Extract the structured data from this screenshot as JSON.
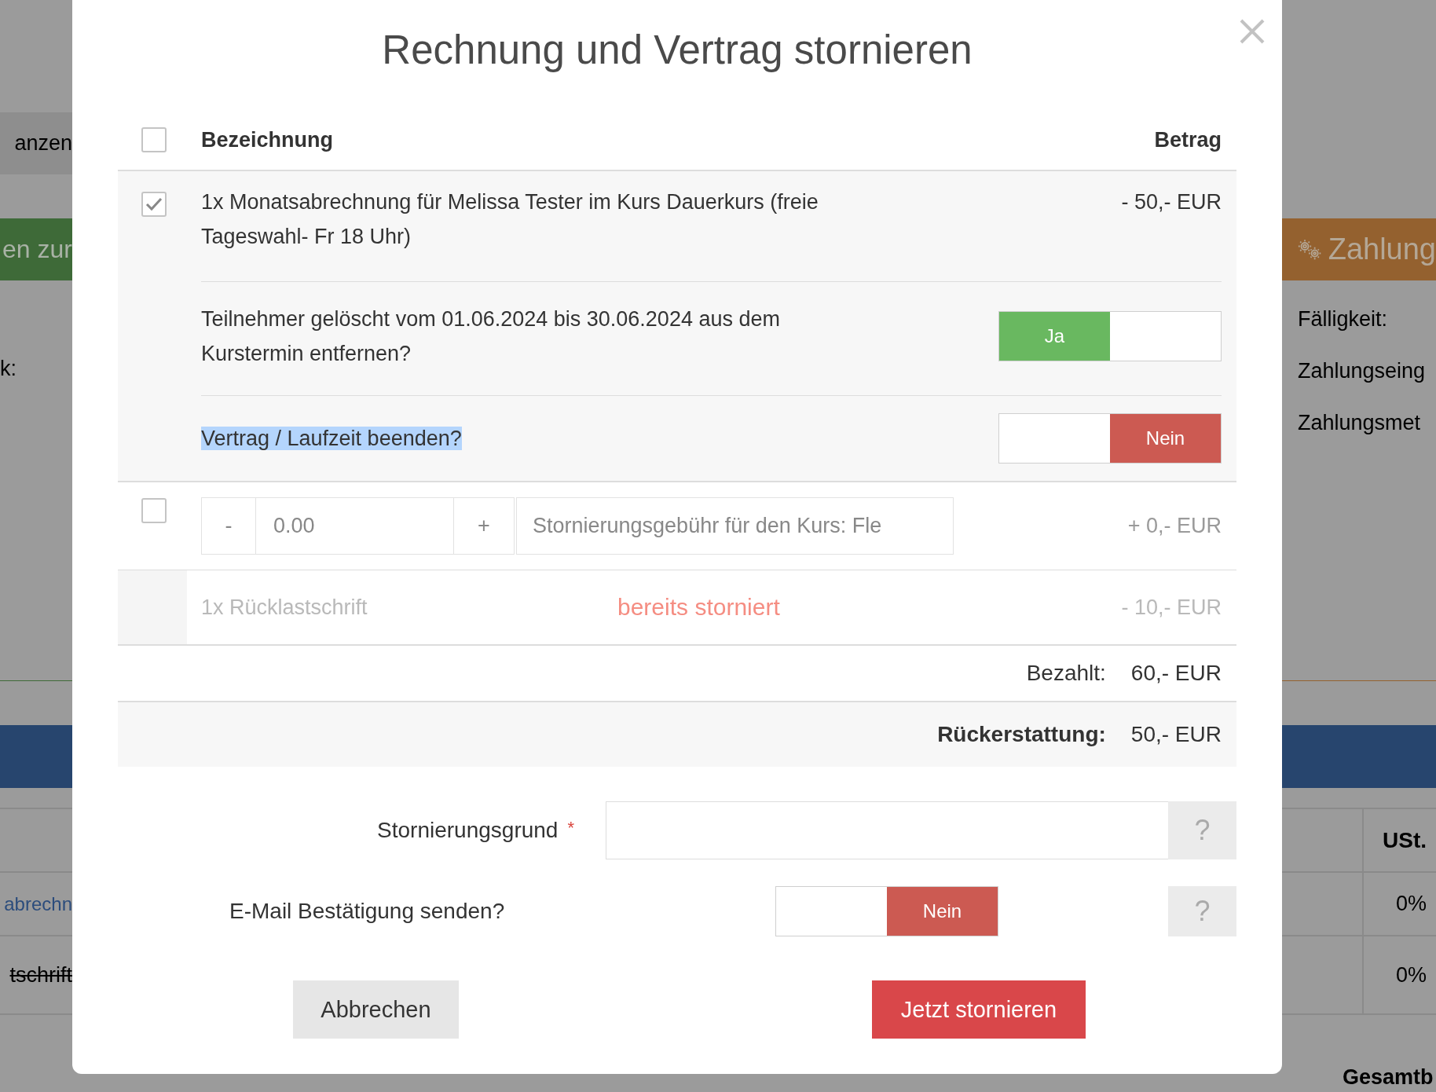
{
  "background_page": {
    "tab_text": "anzen",
    "left_banner": "en zur",
    "left_label": "k:",
    "right_banner": "Zahlung",
    "right_fields": [
      "Fälligkeit:",
      "Zahlungseing",
      "Zahlungsmet"
    ],
    "table": {
      "header": "USt.",
      "rows": [
        {
          "kind": "link",
          "text": "abrechn",
          "vat": "0%"
        },
        {
          "kind": "cancelled",
          "text": "tschrift",
          "vat": "0%"
        }
      ]
    },
    "footer": "Gesamtb"
  },
  "dialog": {
    "title": "Rechnung und Vertrag stornieren",
    "table": {
      "select_all": {
        "checked": false
      },
      "columns": [
        "Bezeichnung",
        "Betrag"
      ],
      "items": [
        {
          "kind": "invoice",
          "checked": true,
          "text": "1x Monatsabrechnung für Melissa Tester im Kurs Dauerkurs (freie Tageswahl- Fr 18 Uhr)",
          "amount": "- 50,- EUR",
          "options": [
            {
              "label": "Teilnehmer gelöscht vom 01.06.2024 bis 30.06.2024 aus dem Kurstermin entfernen?",
              "highlighted": false,
              "toggle": {
                "on": true,
                "label": "Ja"
              }
            },
            {
              "label": "Vertrag / Laufzeit beenden?",
              "highlighted": true,
              "toggle": {
                "on": false,
                "label": "Nein"
              }
            }
          ]
        },
        {
          "kind": "fee",
          "checked": false,
          "minus": "-",
          "value": "0.00",
          "plus": "+",
          "description": "Stornierungsgebühr für den Kurs: Fle",
          "amount": "+ 0,- EUR"
        },
        {
          "kind": "cancelled",
          "text": "1x Rücklastschrift",
          "status": "bereits storniert",
          "amount": "- 10,- EUR"
        }
      ]
    },
    "summary": [
      {
        "label": "Bezahlt:",
        "value": "60,- EUR",
        "emphasized": false
      },
      {
        "label": "Rückerstattung:",
        "value": "50,- EUR",
        "emphasized": true
      }
    ],
    "reason": {
      "label": "Stornierungsgrund",
      "required_mark": "*",
      "help": "?"
    },
    "email": {
      "label": "E-Mail Bestätigung senden?",
      "toggle": {
        "on": false,
        "label": "Nein"
      },
      "help": "?"
    },
    "buttons": [
      {
        "kind": "secondary",
        "label": "Abbrechen"
      },
      {
        "kind": "danger",
        "label": "Jetzt stornieren"
      }
    ]
  }
}
